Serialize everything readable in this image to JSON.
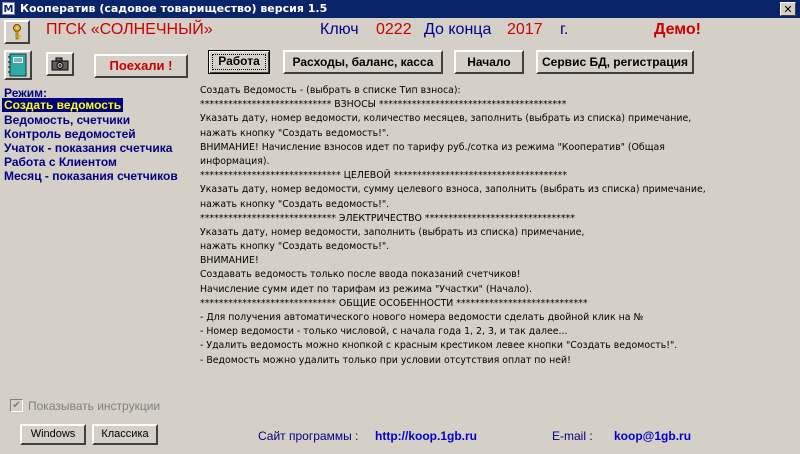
{
  "window": {
    "title": "Кооператив (садовое товарищество) версия 1.5",
    "close_glyph": "✕"
  },
  "header": {
    "org_name": "ПГСК «СОЛНЕЧНЫЙ»",
    "key_label": "Ключ",
    "key_value": "0222",
    "until_label": "До конца",
    "year": "2017",
    "year_suffix": "г.",
    "demo": "Демо!"
  },
  "toolbar": {
    "go_label": "Поехали !",
    "tabs": [
      {
        "label": "Работа",
        "active": true
      },
      {
        "label": "Расходы, баланс, касса"
      },
      {
        "label": "Начало"
      },
      {
        "label": "Сервис БД, регистрация"
      }
    ]
  },
  "sidebar": {
    "mode_label": "Режим:",
    "items": [
      {
        "label": "Создать ведомость",
        "selected": true
      },
      {
        "label": "Ведомость, счетчики"
      },
      {
        "label": "Контроль ведомостей"
      },
      {
        "label": "Учаток - показания счетчика"
      },
      {
        "label": "Работа с Клиентом"
      },
      {
        "label": "Месяц - показания счетчиков"
      }
    ]
  },
  "instructions": [
    "Создать Ведомость - (выбрать в списке Тип взноса):",
    "****************************             ВЗНОСЫ            ****************************************",
    "Указать дату, номер ведомости, количество месяцев, заполнить (выбрать из списка) примечание,",
    "нажать кнопку \"Создать ведомость!\".",
    "ВНИМАНИЕ! Начисление взносов идет по тарифу руб./сотка из режима \"Кооператив\" (Общая",
    "информация).",
    "******************************          ЦЕЛЕВОЙ          *************************************",
    "Указать дату, номер ведомости, сумму целевого взноса, заполнить (выбрать из списка) примечание,",
    "нажать кнопку \"Создать ведомость!\".",
    "*****************************    ЭЛЕКТРИЧЕСТВО   ********************************",
    "Указать дату, номер ведомости, заполнить (выбрать из списка) примечание,",
    "нажать кнопку \"Создать ведомость!\".",
    "ВНИМАНИЕ!",
    "Создавать ведомость только после ввода показаний счетчиков!",
    "Начисление сумм идет по тарифам из режима \"Участки\" (Начало).",
    "*****************************     ОБЩИЕ ОСОБЕННОСТИ    ****************************",
    "- Для получения автоматического нового номера ведомости сделать двойной клик на №",
    "- Номер ведомости - только числовой, с начала года 1, 2, 3, и так далее...",
    "- Удалить ведомость можно кнопкой с красным крестиком левее кнопки \"Создать ведомость!\".",
    "- Ведомость можно удалить только при условии отсутствия оплат по ней!"
  ],
  "options": {
    "show_instructions_label": "Показывать инструкции",
    "show_instructions_checked": true
  },
  "footer": {
    "windows_button": "Windows",
    "classic_button": "Классика",
    "site_label": "Сайт программы :",
    "site_url": "http://koop.1gb.ru",
    "email_label": "E-mail :",
    "email": "koop@1gb.ru"
  },
  "icons": {
    "help": "key-question-icon",
    "book": "notebook-icon",
    "camera": "camera-icon"
  },
  "colors": {
    "title_bar": "#0a246a",
    "accent_red": "#cc0000",
    "nav_blue": "#000080",
    "selected_text": "#ffff00",
    "link_blue": "#0000cc"
  }
}
